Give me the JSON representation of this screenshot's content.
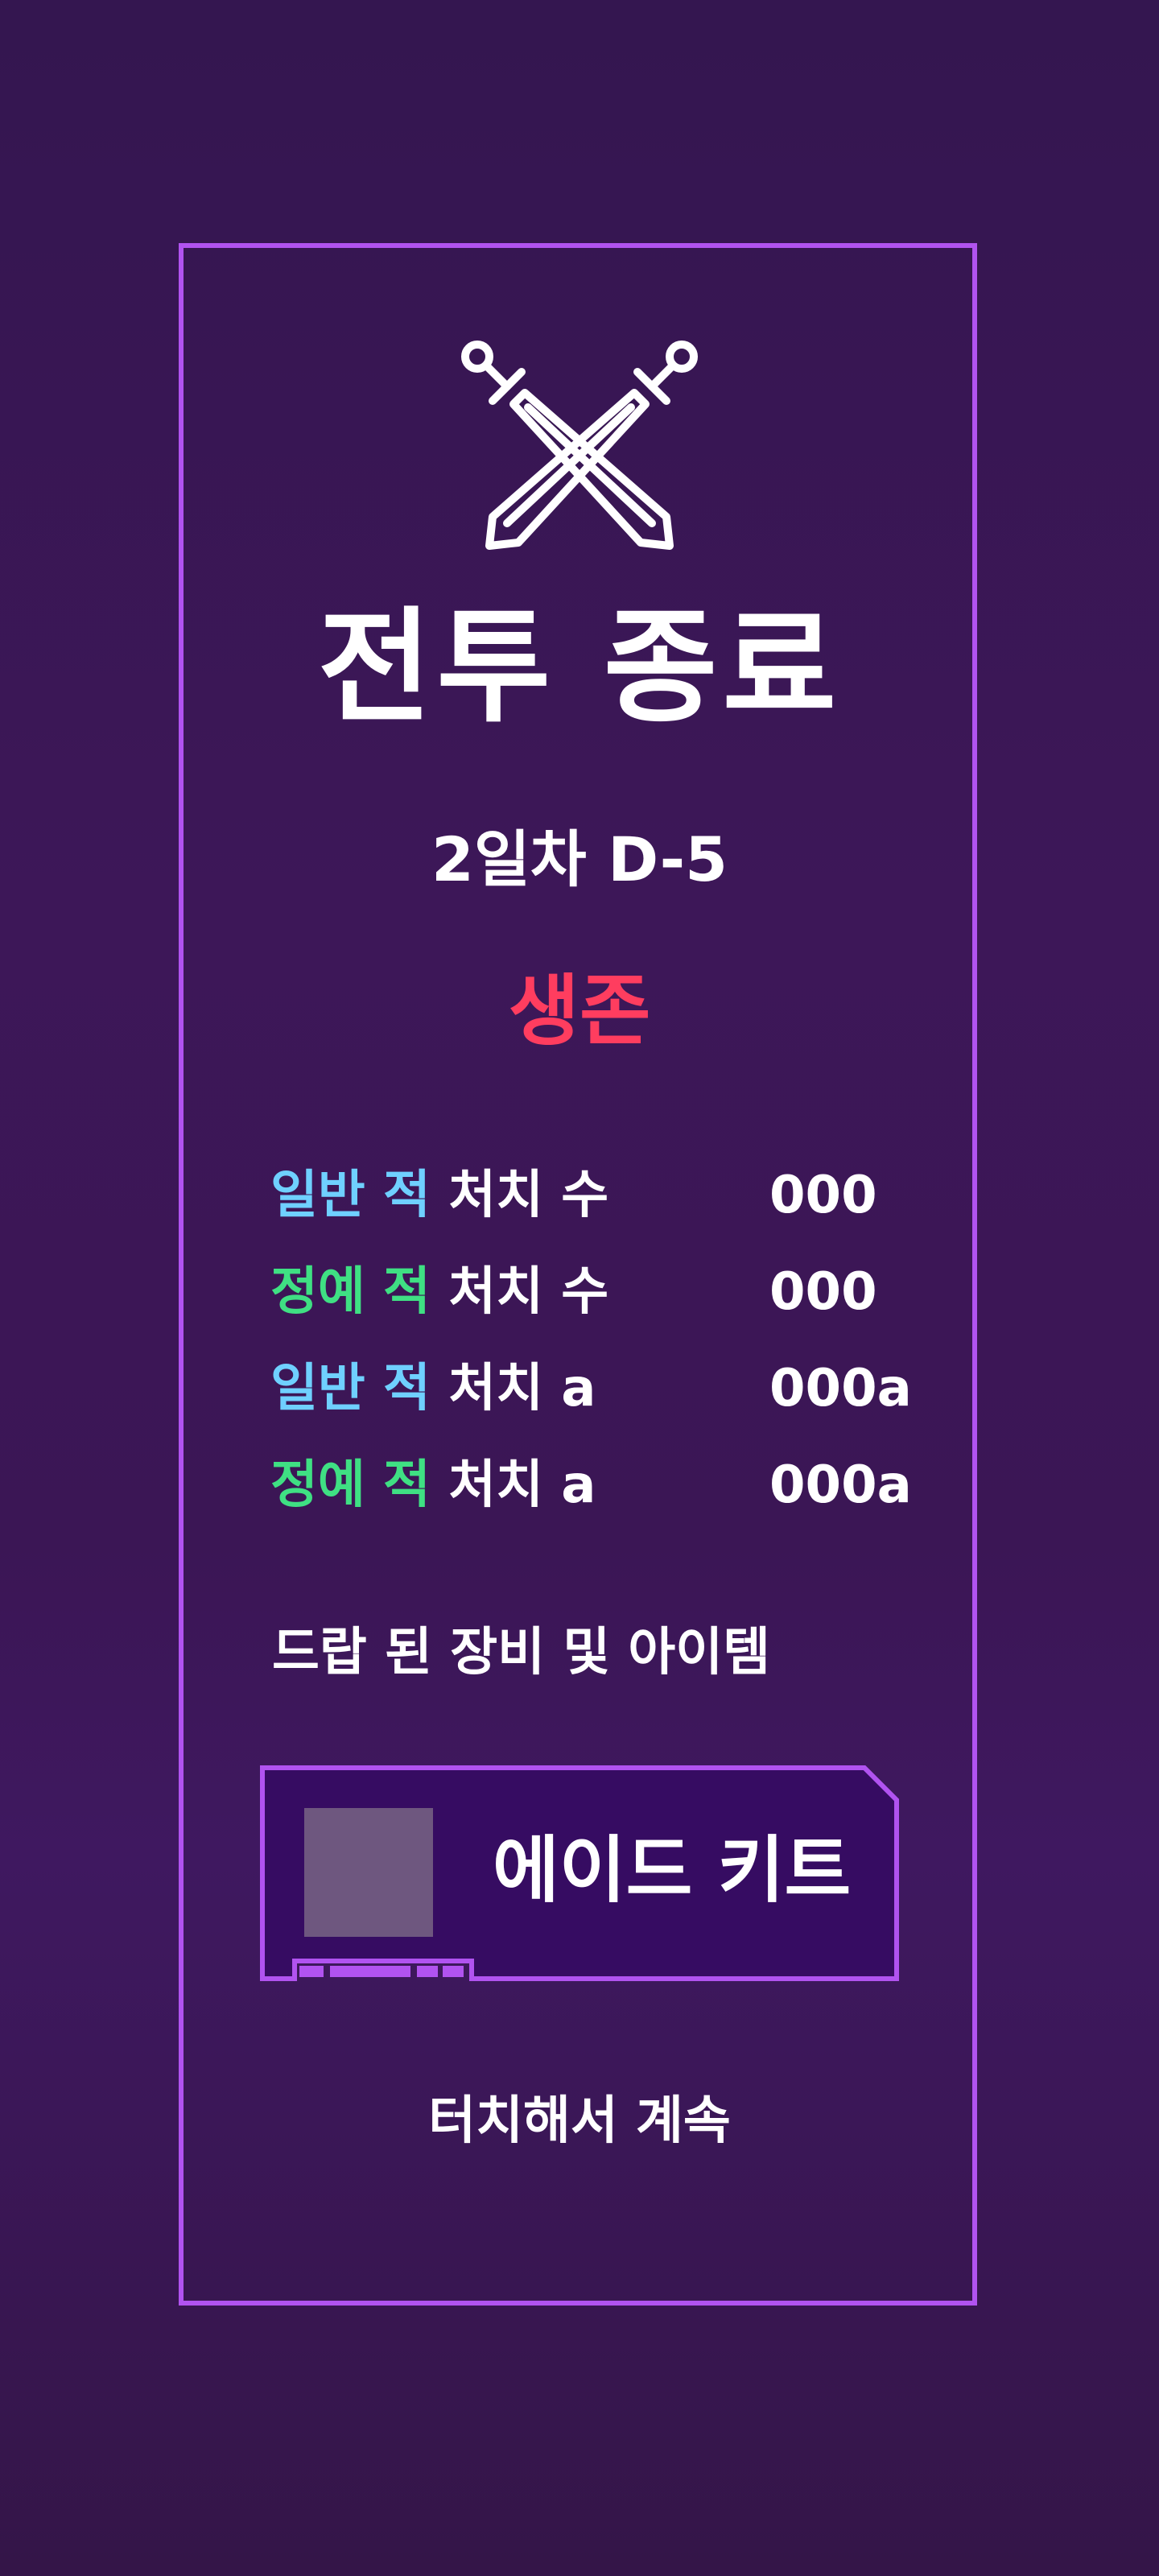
{
  "colors": {
    "border": "#b153f0",
    "survive": "#ff3d5f",
    "normal_enemy": "#6fd0ff",
    "elite_enemy": "#3fe083",
    "text": "#ffffff"
  },
  "icon": "crossed-swords-icon",
  "title": "전투 종료",
  "stage": "2일차 D-5",
  "result": "생존",
  "stats": [
    {
      "tag": "일반 적",
      "label": " 처치 수",
      "value": "000",
      "tag_color": "#6fd0ff"
    },
    {
      "tag": "정예 적",
      "label": " 처치 수",
      "value": "000",
      "tag_color": "#3fe083"
    },
    {
      "tag": "일반 적",
      "label": " 처치 a",
      "value": "000a",
      "tag_color": "#6fd0ff"
    },
    {
      "tag": "정예 적",
      "label": " 처치 a",
      "value": "000a",
      "tag_color": "#3fe083"
    }
  ],
  "drops_heading": "드랍 된 장비 및 아이템",
  "drop_item": {
    "name": "에이드 키트"
  },
  "continue_text": "터치해서 계속"
}
